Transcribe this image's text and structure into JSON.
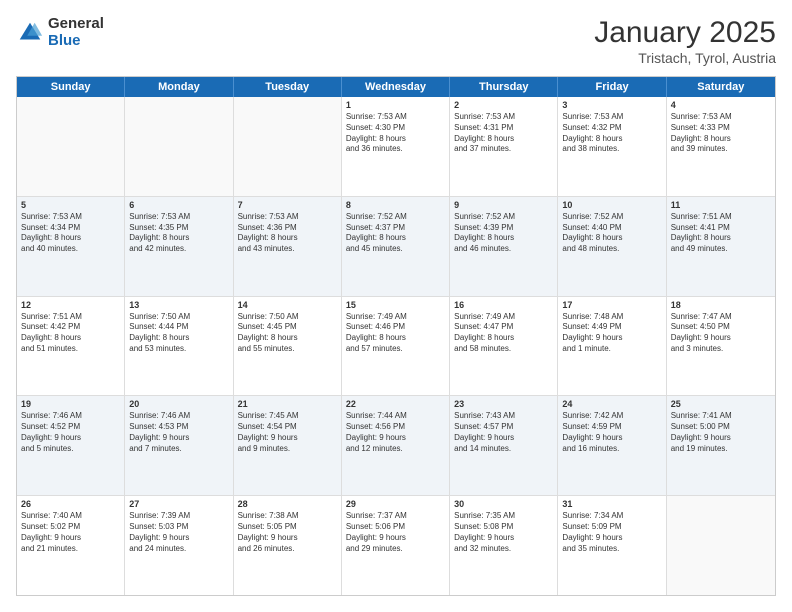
{
  "logo": {
    "general": "General",
    "blue": "Blue"
  },
  "header": {
    "month": "January 2025",
    "location": "Tristach, Tyrol, Austria"
  },
  "weekdays": [
    "Sunday",
    "Monday",
    "Tuesday",
    "Wednesday",
    "Thursday",
    "Friday",
    "Saturday"
  ],
  "rows": [
    {
      "alt": false,
      "cells": [
        {
          "day": "",
          "info": ""
        },
        {
          "day": "",
          "info": ""
        },
        {
          "day": "",
          "info": ""
        },
        {
          "day": "1",
          "info": "Sunrise: 7:53 AM\nSunset: 4:30 PM\nDaylight: 8 hours\nand 36 minutes."
        },
        {
          "day": "2",
          "info": "Sunrise: 7:53 AM\nSunset: 4:31 PM\nDaylight: 8 hours\nand 37 minutes."
        },
        {
          "day": "3",
          "info": "Sunrise: 7:53 AM\nSunset: 4:32 PM\nDaylight: 8 hours\nand 38 minutes."
        },
        {
          "day": "4",
          "info": "Sunrise: 7:53 AM\nSunset: 4:33 PM\nDaylight: 8 hours\nand 39 minutes."
        }
      ]
    },
    {
      "alt": true,
      "cells": [
        {
          "day": "5",
          "info": "Sunrise: 7:53 AM\nSunset: 4:34 PM\nDaylight: 8 hours\nand 40 minutes."
        },
        {
          "day": "6",
          "info": "Sunrise: 7:53 AM\nSunset: 4:35 PM\nDaylight: 8 hours\nand 42 minutes."
        },
        {
          "day": "7",
          "info": "Sunrise: 7:53 AM\nSunset: 4:36 PM\nDaylight: 8 hours\nand 43 minutes."
        },
        {
          "day": "8",
          "info": "Sunrise: 7:52 AM\nSunset: 4:37 PM\nDaylight: 8 hours\nand 45 minutes."
        },
        {
          "day": "9",
          "info": "Sunrise: 7:52 AM\nSunset: 4:39 PM\nDaylight: 8 hours\nand 46 minutes."
        },
        {
          "day": "10",
          "info": "Sunrise: 7:52 AM\nSunset: 4:40 PM\nDaylight: 8 hours\nand 48 minutes."
        },
        {
          "day": "11",
          "info": "Sunrise: 7:51 AM\nSunset: 4:41 PM\nDaylight: 8 hours\nand 49 minutes."
        }
      ]
    },
    {
      "alt": false,
      "cells": [
        {
          "day": "12",
          "info": "Sunrise: 7:51 AM\nSunset: 4:42 PM\nDaylight: 8 hours\nand 51 minutes."
        },
        {
          "day": "13",
          "info": "Sunrise: 7:50 AM\nSunset: 4:44 PM\nDaylight: 8 hours\nand 53 minutes."
        },
        {
          "day": "14",
          "info": "Sunrise: 7:50 AM\nSunset: 4:45 PM\nDaylight: 8 hours\nand 55 minutes."
        },
        {
          "day": "15",
          "info": "Sunrise: 7:49 AM\nSunset: 4:46 PM\nDaylight: 8 hours\nand 57 minutes."
        },
        {
          "day": "16",
          "info": "Sunrise: 7:49 AM\nSunset: 4:47 PM\nDaylight: 8 hours\nand 58 minutes."
        },
        {
          "day": "17",
          "info": "Sunrise: 7:48 AM\nSunset: 4:49 PM\nDaylight: 9 hours\nand 1 minute."
        },
        {
          "day": "18",
          "info": "Sunrise: 7:47 AM\nSunset: 4:50 PM\nDaylight: 9 hours\nand 3 minutes."
        }
      ]
    },
    {
      "alt": true,
      "cells": [
        {
          "day": "19",
          "info": "Sunrise: 7:46 AM\nSunset: 4:52 PM\nDaylight: 9 hours\nand 5 minutes."
        },
        {
          "day": "20",
          "info": "Sunrise: 7:46 AM\nSunset: 4:53 PM\nDaylight: 9 hours\nand 7 minutes."
        },
        {
          "day": "21",
          "info": "Sunrise: 7:45 AM\nSunset: 4:54 PM\nDaylight: 9 hours\nand 9 minutes."
        },
        {
          "day": "22",
          "info": "Sunrise: 7:44 AM\nSunset: 4:56 PM\nDaylight: 9 hours\nand 12 minutes."
        },
        {
          "day": "23",
          "info": "Sunrise: 7:43 AM\nSunset: 4:57 PM\nDaylight: 9 hours\nand 14 minutes."
        },
        {
          "day": "24",
          "info": "Sunrise: 7:42 AM\nSunset: 4:59 PM\nDaylight: 9 hours\nand 16 minutes."
        },
        {
          "day": "25",
          "info": "Sunrise: 7:41 AM\nSunset: 5:00 PM\nDaylight: 9 hours\nand 19 minutes."
        }
      ]
    },
    {
      "alt": false,
      "cells": [
        {
          "day": "26",
          "info": "Sunrise: 7:40 AM\nSunset: 5:02 PM\nDaylight: 9 hours\nand 21 minutes."
        },
        {
          "day": "27",
          "info": "Sunrise: 7:39 AM\nSunset: 5:03 PM\nDaylight: 9 hours\nand 24 minutes."
        },
        {
          "day": "28",
          "info": "Sunrise: 7:38 AM\nSunset: 5:05 PM\nDaylight: 9 hours\nand 26 minutes."
        },
        {
          "day": "29",
          "info": "Sunrise: 7:37 AM\nSunset: 5:06 PM\nDaylight: 9 hours\nand 29 minutes."
        },
        {
          "day": "30",
          "info": "Sunrise: 7:35 AM\nSunset: 5:08 PM\nDaylight: 9 hours\nand 32 minutes."
        },
        {
          "day": "31",
          "info": "Sunrise: 7:34 AM\nSunset: 5:09 PM\nDaylight: 9 hours\nand 35 minutes."
        },
        {
          "day": "",
          "info": ""
        }
      ]
    }
  ]
}
